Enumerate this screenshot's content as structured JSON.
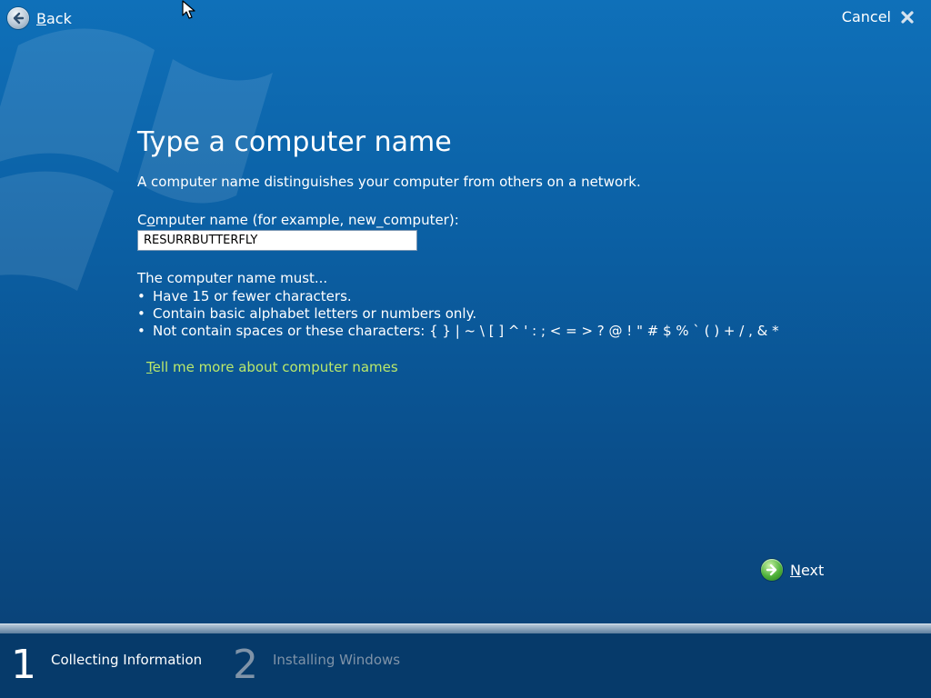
{
  "header": {
    "back_label_mnemonic": "B",
    "back_label_rest": "ack",
    "cancel_label": "Cancel"
  },
  "main": {
    "title": "Type a computer name",
    "description": "A computer name distinguishes your computer from others on a network.",
    "field_label_pre": "C",
    "field_label_mnemonic": "o",
    "field_label_rest": "mputer name (for example, new_computer):",
    "computer_name_value": "RESURRBUTTERFLY",
    "rules_heading": "The computer name must...",
    "rules": [
      "Have 15 or fewer characters.",
      "Contain basic alphabet letters or numbers only.",
      "Not contain spaces or these characters:  { } | ~ \\ [ ] ^ ' : ; < = > ? @ ! \" # $ % ` ( ) + / , & *"
    ],
    "help_link_mnemonic": "T",
    "help_link_rest": "ell me more about computer names"
  },
  "footer_nav": {
    "next_mnemonic": "N",
    "next_rest": "ext"
  },
  "steps": [
    {
      "number": "1",
      "label": "Collecting Information",
      "state": "active"
    },
    {
      "number": "2",
      "label": "Installing Windows",
      "state": "inactive"
    }
  ]
}
